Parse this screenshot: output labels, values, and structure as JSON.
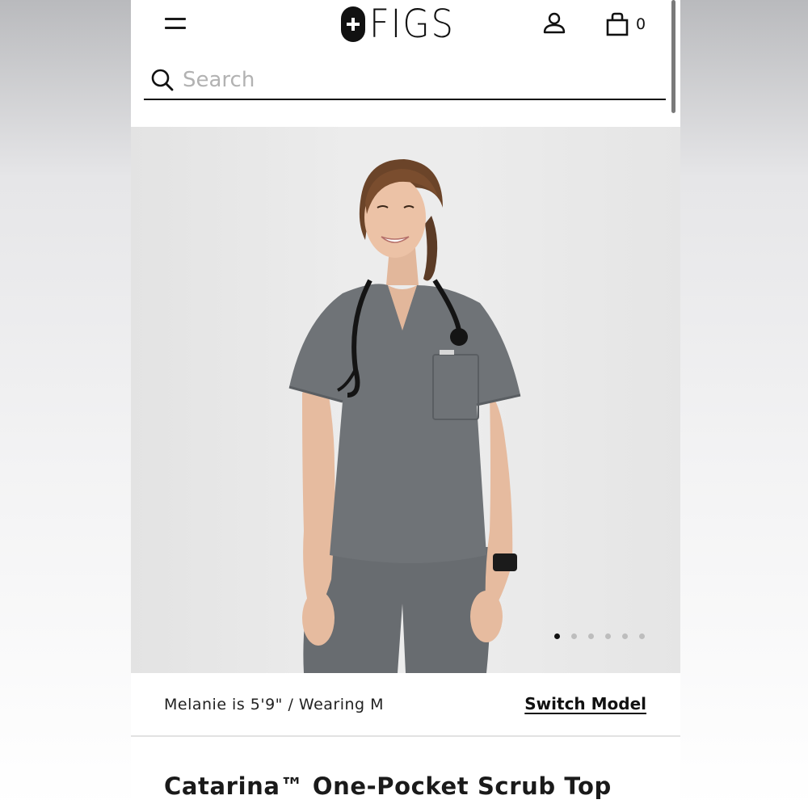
{
  "header": {
    "brand": "FIGS",
    "cart_count": "0"
  },
  "search": {
    "placeholder": "Search"
  },
  "gallery": {
    "image_count": 6,
    "active_index": 0
  },
  "model_info": {
    "text": "Melanie is 5'9\" / Wearing M",
    "switch_label": "Switch Model"
  },
  "product": {
    "title": "Catarina™ One-Pocket Scrub Top"
  },
  "colors": {
    "scrub_gray": "#6f7377",
    "background": "#ececec",
    "text": "#111111"
  }
}
